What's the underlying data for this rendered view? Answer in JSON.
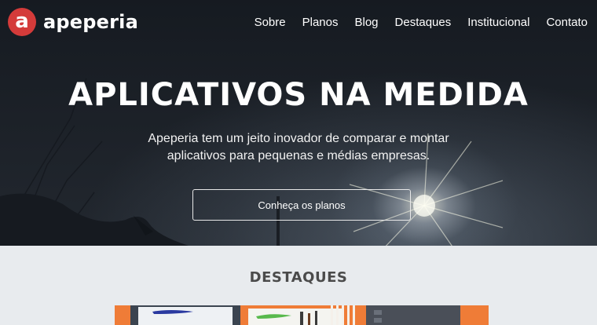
{
  "brand": {
    "logo_letter": "a",
    "name": "apeperia",
    "color": "#d43b3a"
  },
  "nav": {
    "items": [
      "Sobre",
      "Planos",
      "Blog",
      "Destaques",
      "Institucional",
      "Contato"
    ]
  },
  "hero": {
    "title": "APLICATIVOS NA MEDIDA",
    "subtitle_line1": "Apeperia tem um jeito inovador de comparar e montar",
    "subtitle_line2": "aplicativos para pequenas e médias empresas.",
    "cta_label": "Conheça os planos"
  },
  "highlights": {
    "title": "DESTAQUES",
    "accent": "#ef7c37"
  }
}
